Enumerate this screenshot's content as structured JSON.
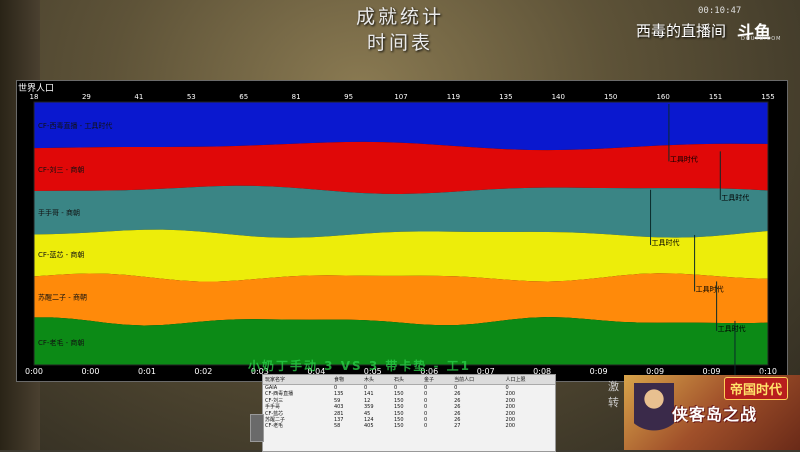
{
  "header": {
    "title": "成就统计",
    "subtitle": "时间表",
    "clock": "00:10:47"
  },
  "streamer": {
    "name": "西毒的直播间",
    "logo": "斗鱼",
    "site": "DOUYU.COM"
  },
  "chart_data": {
    "type": "area",
    "title": "世界人口",
    "stacked": true,
    "normalized": true,
    "top_ticks": [
      "18",
      "29",
      "41",
      "53",
      "65",
      "81",
      "95",
      "107",
      "119",
      "135",
      "140",
      "150",
      "160",
      "151",
      "155"
    ],
    "time_ticks": [
      "0:00",
      "0:00",
      "0:01",
      "0:02",
      "0:03",
      "0:04",
      "0:05",
      "0:06",
      "0:07",
      "0:08",
      "0:09",
      "0:09",
      "0:09",
      "0:10"
    ],
    "series": [
      {
        "name": "CF-西毒直播 - 工具时代",
        "color": "#0a18cf"
      },
      {
        "name": "CF-刘三 - 商朝",
        "color": "#e00808"
      },
      {
        "name": "手手哥 - 商朝",
        "color": "#3a8585"
      },
      {
        "name": "CF-蓝芯 - 商朝",
        "color": "#eded0a"
      },
      {
        "name": "苏醒二子 - 商朝",
        "color": "#ff8a0a"
      },
      {
        "name": "CF-老毛 - 商朝",
        "color": "#0c8a16"
      }
    ],
    "age_event_label": "工具时代"
  },
  "overlay_text": "小奶丁手动 3 VS 3 带卡垫 - 工1",
  "stats_table": {
    "headers": [
      "玩家名字",
      "食物",
      "木头",
      "石头",
      "金子",
      "当前人口",
      "人口上限"
    ],
    "rows": [
      [
        "GAIA",
        "0",
        "0",
        "0",
        "0",
        "0",
        "0"
      ],
      [
        "CF-西毒直播",
        "135",
        "141",
        "150",
        "0",
        "26",
        "200"
      ],
      [
        "CF-刘三",
        "59",
        "12",
        "150",
        "0",
        "26",
        "200"
      ],
      [
        "手手哥",
        "403",
        "359",
        "150",
        "0",
        "26",
        "200"
      ],
      [
        "CF-蓝芯",
        "281",
        "45",
        "150",
        "0",
        "26",
        "200"
      ],
      [
        "苏醒二子",
        "137",
        "124",
        "150",
        "0",
        "26",
        "200"
      ],
      [
        "CF-老毛",
        "58",
        "405",
        "150",
        "0",
        "27",
        "200"
      ]
    ]
  },
  "side_text": "激\n转",
  "promo": {
    "badge": "帝国时代",
    "title": "侠客岛之战"
  }
}
